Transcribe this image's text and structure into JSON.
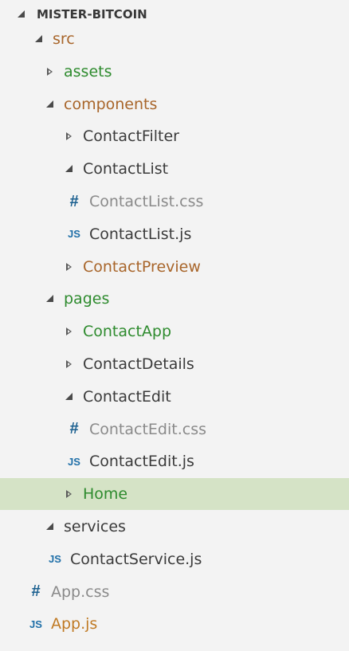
{
  "explorer": {
    "title": "MISTER-BITCOIN",
    "items": [
      {
        "label": "src",
        "kind": "folder",
        "state": "expanded",
        "depth": 1,
        "color": "orange"
      },
      {
        "label": "assets",
        "kind": "folder",
        "state": "collapsed",
        "depth": 2,
        "color": "green"
      },
      {
        "label": "components",
        "kind": "folder",
        "state": "expanded",
        "depth": 2,
        "color": "orange"
      },
      {
        "label": "ContactFilter",
        "kind": "folder",
        "state": "collapsed",
        "depth": 3,
        "color": "dark"
      },
      {
        "label": "ContactList",
        "kind": "folder",
        "state": "expanded",
        "depth": 3,
        "color": "dark"
      },
      {
        "label": "ContactList.css",
        "kind": "css",
        "depth": 4,
        "color": "grey",
        "icon": "#"
      },
      {
        "label": "ContactList.js",
        "kind": "js",
        "depth": 4,
        "color": "dark",
        "icon": "JS"
      },
      {
        "label": "ContactPreview",
        "kind": "folder",
        "state": "collapsed",
        "depth": 3,
        "color": "orange"
      },
      {
        "label": "pages",
        "kind": "folder",
        "state": "expanded",
        "depth": 2,
        "color": "green"
      },
      {
        "label": "ContactApp",
        "kind": "folder",
        "state": "collapsed",
        "depth": 3,
        "color": "green"
      },
      {
        "label": "ContactDetails",
        "kind": "folder",
        "state": "collapsed",
        "depth": 3,
        "color": "dark"
      },
      {
        "label": "ContactEdit",
        "kind": "folder",
        "state": "expanded",
        "depth": 3,
        "color": "dark"
      },
      {
        "label": "ContactEdit.css",
        "kind": "css",
        "depth": 4,
        "color": "grey",
        "icon": "#"
      },
      {
        "label": "ContactEdit.js",
        "kind": "js",
        "depth": 4,
        "color": "dark",
        "icon": "JS"
      },
      {
        "label": "Home",
        "kind": "folder",
        "state": "collapsed",
        "depth": 3,
        "color": "green",
        "selected": true
      },
      {
        "label": "services",
        "kind": "folder",
        "state": "expanded",
        "depth": 2,
        "color": "dark"
      },
      {
        "label": "ContactService.js",
        "kind": "js",
        "depth": 3,
        "color": "dark",
        "icon": "JS"
      },
      {
        "label": "App.css",
        "kind": "css",
        "depth": 2,
        "color": "grey",
        "icon": "#"
      },
      {
        "label": "App.js",
        "kind": "js",
        "depth": 2,
        "color": "gold",
        "icon": "JS"
      }
    ]
  }
}
